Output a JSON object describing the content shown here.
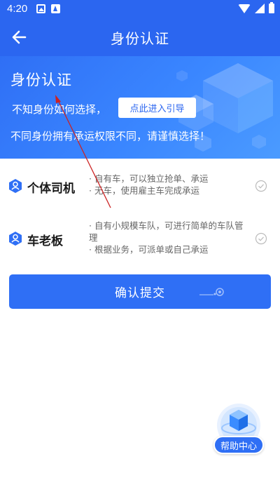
{
  "status_bar": {
    "time": "4:20"
  },
  "nav": {
    "title": "身份认证",
    "back_icon": "arrow-left-icon"
  },
  "banner": {
    "title": "身份认证",
    "question": "不知身份如何选择，",
    "guide_button": "点此进入引导",
    "note": "不同身份拥有承运权限不同，请谨慎选择！"
  },
  "roles": [
    {
      "name": "个体司机",
      "icon": "driver-user-icon",
      "desc": [
        "· 自有车，可以独立抢单、承运",
        "· 无车，使用雇主车完成承运"
      ]
    },
    {
      "name": "车老板",
      "icon": "boss-user-icon",
      "desc": [
        "· 自有小规模车队，可进行简单的车队管理",
        "· 根据业务，可派单或自己承运"
      ]
    }
  ],
  "submit": {
    "label": "确认提交"
  },
  "help": {
    "label": "帮助中心"
  },
  "colors": {
    "primary": "#2b66f0",
    "banner_light": "#4b9bff",
    "annotation": "#cc2222"
  }
}
